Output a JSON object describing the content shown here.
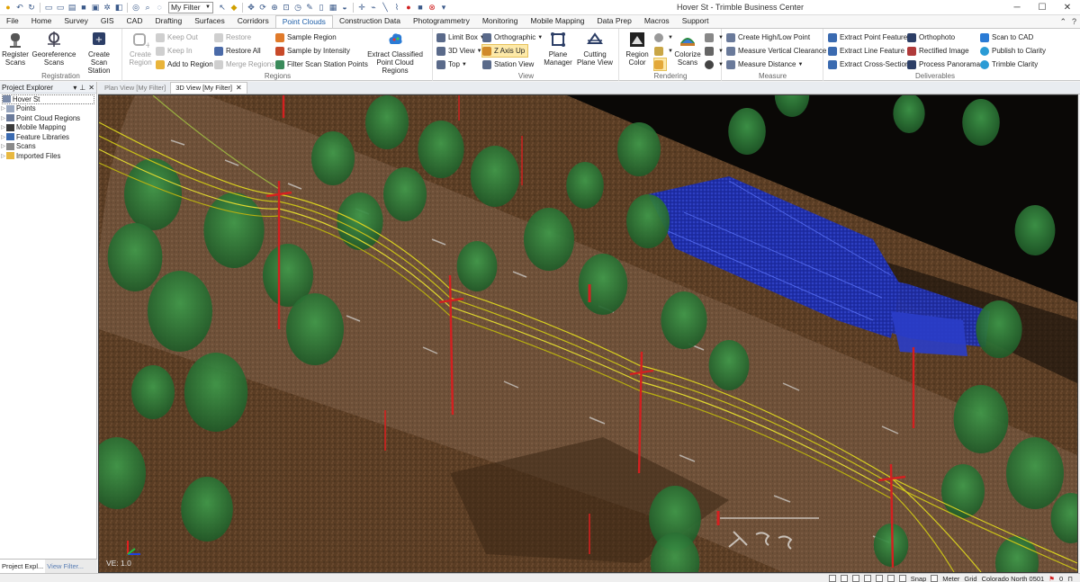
{
  "window": {
    "title": "Hover St - Trimble Business Center",
    "filter_value": "My Filter"
  },
  "tabs": [
    "File",
    "Home",
    "Survey",
    "GIS",
    "CAD",
    "Drafting",
    "Surfaces",
    "Corridors",
    "Point Clouds",
    "Construction Data",
    "Photogrammetry",
    "Monitoring",
    "Mobile Mapping",
    "Data Prep",
    "Macros",
    "Support"
  ],
  "active_tab": "Point Clouds",
  "ribbon": {
    "registration": {
      "label": "Registration",
      "register_scans": "Register Scans",
      "georeference_scans": "Georeference Scans",
      "create_scan_station": "Create Scan Station"
    },
    "regions": {
      "label": "Regions",
      "create_region": "Create Region",
      "keep_out": "Keep Out",
      "keep_in": "Keep In",
      "add_to_region": "Add to Region",
      "restore": "Restore",
      "restore_all": "Restore All",
      "merge_regions": "Merge Regions",
      "sample_region": "Sample Region",
      "sample_by_intensity": "Sample by Intensity",
      "filter_scan_station_points": "Filter Scan Station Points",
      "extract_classified": "Extract Classified Point Cloud Regions"
    },
    "view": {
      "label": "View",
      "limit_box": "Limit Box",
      "view_3d": "3D View",
      "top": "Top",
      "orthographic": "Orthographic",
      "z_axis_up": "Z Axis Up",
      "station_view": "Station View",
      "plane_manager": "Plane Manager",
      "cutting_plane_view": "Cutting Plane View"
    },
    "rendering": {
      "label": "Rendering",
      "region_color": "Region Color",
      "colorize_scans": "Colorize Scans"
    },
    "measure": {
      "label": "Measure",
      "create_high_low_point": "Create High/Low Point",
      "measure_vertical_clearance": "Measure Vertical Clearance",
      "measure_distance": "Measure Distance"
    },
    "deliverables": {
      "label": "Deliverables",
      "extract_point_feature": "Extract Point Feature",
      "extract_line_feature": "Extract Line Feature",
      "extract_cross_sections": "Extract Cross-Sections",
      "orthophoto": "Orthophoto",
      "rectified_image": "Rectified Image",
      "process_panoramas": "Process Panoramas",
      "scan_to_cad": "Scan to CAD",
      "publish_to_clarity": "Publish to Clarity",
      "trimble_clarity": "Trimble Clarity"
    }
  },
  "explorer": {
    "title": "Project Explorer",
    "root": "Hover St",
    "items": [
      "Points",
      "Point Cloud Regions",
      "Mobile Mapping",
      "Feature Libraries",
      "Scans",
      "Imported Files"
    ],
    "bottom_tabs": [
      "Project Expl...",
      "View Filter..."
    ]
  },
  "view_tabs": [
    "Plan View [My Filter]",
    "3D View [My Filter]"
  ],
  "active_view_tab": "3D View [My Filter]",
  "viewport": {
    "ve_label": "VE: 1.0"
  },
  "status": {
    "snap": "Snap",
    "units": "Meter",
    "grid": "Grid",
    "coord_system": "Colorado North 0501",
    "count": "0"
  },
  "colors": {
    "accent": "#1f5fa8",
    "point_ground": "#6b4a2e",
    "point_vegetation": "#2f7a3a",
    "point_building": "#2b3fd0",
    "point_poles": "#d02020",
    "point_wires": "#d8d020"
  }
}
